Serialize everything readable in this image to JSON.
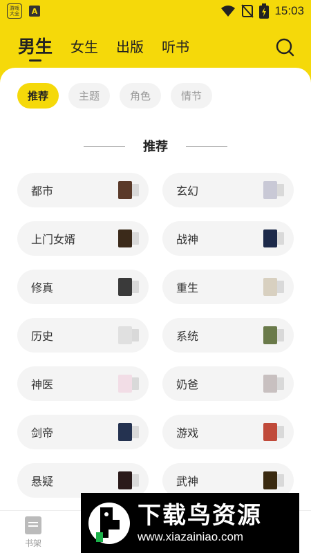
{
  "status_bar": {
    "app_badge": "游戏大全",
    "a_badge": "A",
    "time": "15:03",
    "icons": [
      "wifi-icon",
      "sim-off-icon",
      "battery-charging-icon"
    ]
  },
  "top_tabs": [
    {
      "label": "男生",
      "active": true
    },
    {
      "label": "女生",
      "active": false
    },
    {
      "label": "出版",
      "active": false
    },
    {
      "label": "听书",
      "active": false
    }
  ],
  "search_icon": "search-icon",
  "sub_tabs": [
    {
      "label": "推荐",
      "active": true
    },
    {
      "label": "主题",
      "active": false
    },
    {
      "label": "角色",
      "active": false
    },
    {
      "label": "情节",
      "active": false
    }
  ],
  "section_title": "推荐",
  "categories": [
    {
      "label": "都市",
      "cover_color": "#5a3a2a"
    },
    {
      "label": "玄幻",
      "cover_color": "#c9c9d6"
    },
    {
      "label": "上门女婿",
      "cover_color": "#3b2a1a"
    },
    {
      "label": "战神",
      "cover_color": "#1d2a4a"
    },
    {
      "label": "修真",
      "cover_color": "#3a3a3a"
    },
    {
      "label": "重生",
      "cover_color": "#d8d0c0"
    },
    {
      "label": "历史",
      "cover_color": "#e0e0e0"
    },
    {
      "label": "系统",
      "cover_color": "#6a7a4a"
    },
    {
      "label": "神医",
      "cover_color": "#f2dde6"
    },
    {
      "label": "奶爸",
      "cover_color": "#c8c0c0"
    },
    {
      "label": "剑帝",
      "cover_color": "#243250"
    },
    {
      "label": "游戏",
      "cover_color": "#c04a3a"
    },
    {
      "label": "悬疑",
      "cover_color": "#2a1a1a"
    },
    {
      "label": "武神",
      "cover_color": "#3a2a10"
    }
  ],
  "bottom_nav": {
    "shelf_label": "书架"
  },
  "watermark": {
    "title": "下载鸟资源",
    "url": "www.xiazainiao.com"
  },
  "colors": {
    "accent": "#f5d90a",
    "panel": "#ffffff",
    "chip": "#f4f4f4"
  }
}
